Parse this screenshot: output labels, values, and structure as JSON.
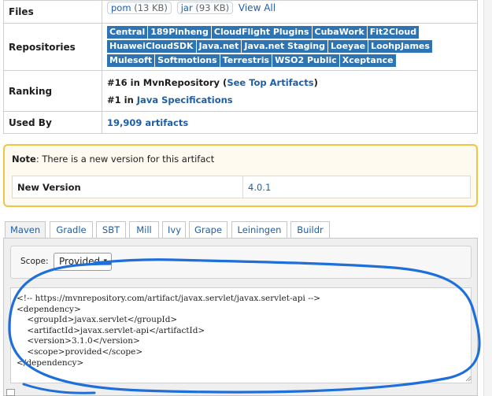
{
  "info": {
    "files_label": "Files",
    "files": [
      {
        "name": "pom",
        "size": "(13 KB)"
      },
      {
        "name": "jar",
        "size": "(93 KB)"
      }
    ],
    "view_all": "View All",
    "repositories_label": "Repositories",
    "repositories": [
      "Central",
      "189Pinheng",
      "CloudFlight Plugins",
      "CubaWork",
      "Fit2Cloud",
      "HuaweiCloudSDK",
      "Java.net",
      "Java.net Staging",
      "Loeyae",
      "LoohpJames",
      "Mulesoft",
      "Softmotions",
      "Terrestris",
      "WSO2 Public",
      "Xceptance"
    ],
    "ranking_label": "Ranking",
    "ranking_1_prefix": "#16 in MvnRepository (",
    "ranking_1_link": "See Top Artifacts",
    "ranking_1_suffix": ")",
    "ranking_2_prefix": "#1 in ",
    "ranking_2_link": "Java Specifications",
    "used_by_label": "Used By",
    "used_by_value": "19,909 artifacts"
  },
  "note": {
    "label": "Note",
    "text": ": There is a new version for this artifact",
    "new_version_label": "New Version",
    "new_version_value": "4.0.1"
  },
  "tabs": [
    "Maven",
    "Gradle",
    "SBT",
    "Mill",
    "Ivy",
    "Grape",
    "Leiningen",
    "Buildr"
  ],
  "active_tab": "Maven",
  "scope": {
    "label": "Scope:",
    "selected": "Provided"
  },
  "code": "<!-- https://mvnrepository.com/artifact/javax.servlet/javax.servlet-api -->\n<dependency>\n    <groupId>javax.servlet</groupId>\n    <artifactId>javax.servlet-api</artifactId>\n    <version>3.1.0</version>\n    <scope>provided</scope>\n</dependency>",
  "colors": {
    "link": "#1f5fa6",
    "repo_badge": "#2c74b3",
    "note_border": "#f3c344",
    "annotation": "#1e6fd9"
  }
}
